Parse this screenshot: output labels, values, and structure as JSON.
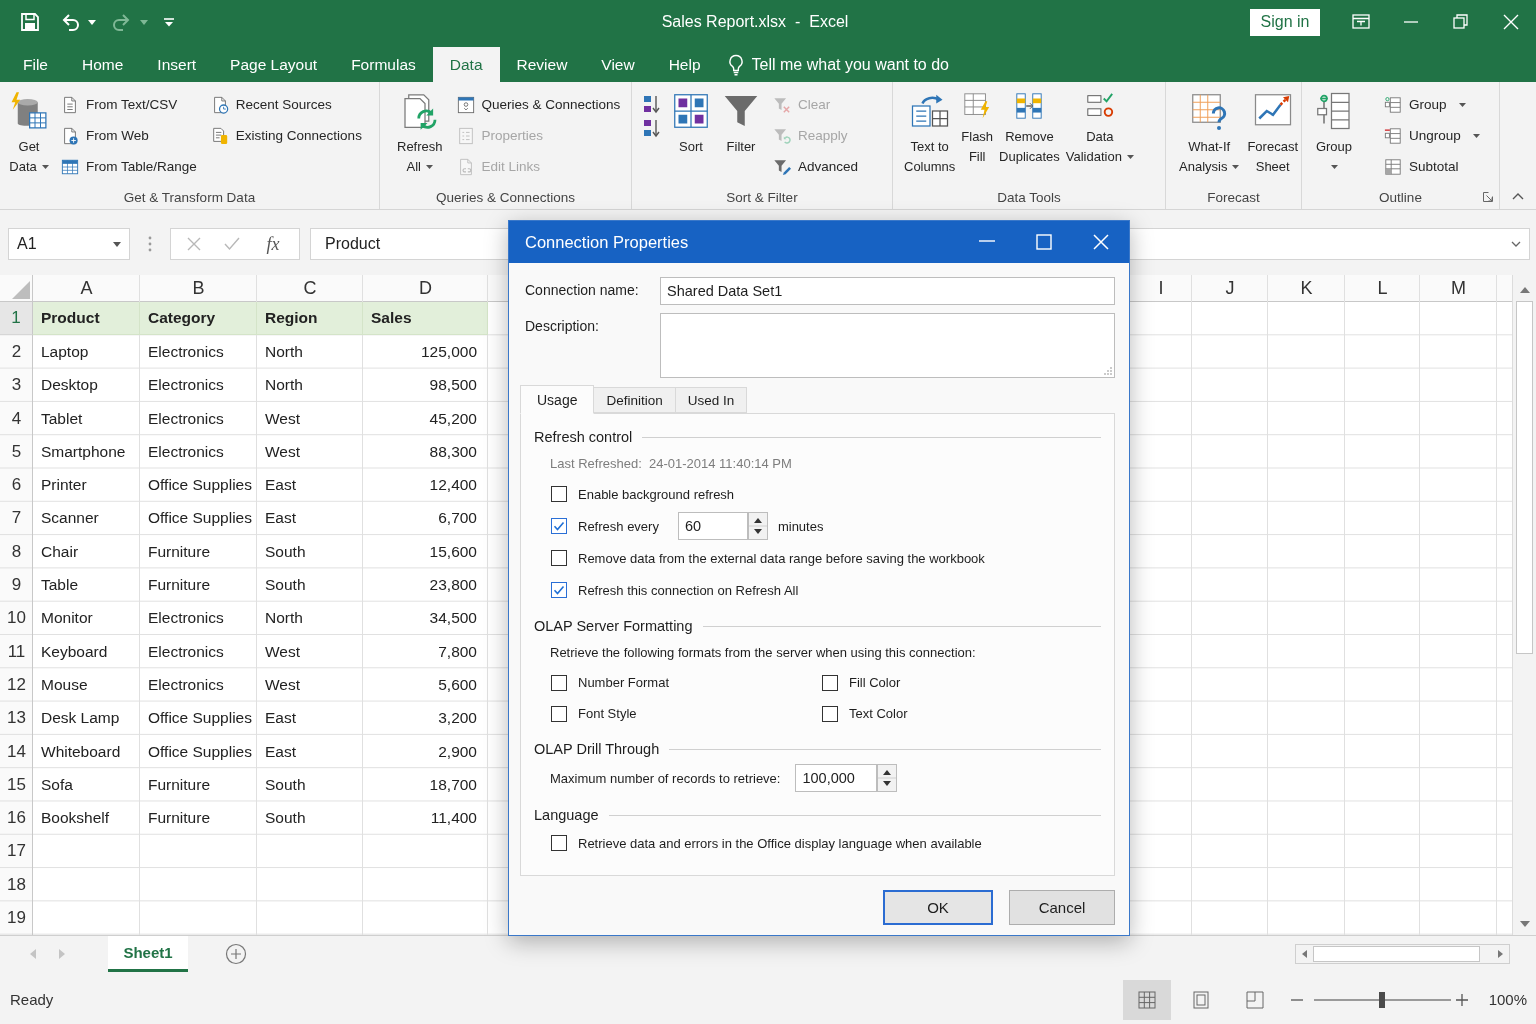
{
  "window": {
    "title": "Sales Report.xlsx  -  Excel",
    "sign_in": "Sign in"
  },
  "quick_access": [
    {
      "kind": "save",
      "disabled": false
    },
    {
      "kind": "undo",
      "disabled": false
    },
    {
      "kind": "redo",
      "disabled": true
    },
    {
      "kind": "customize",
      "disabled": false
    }
  ],
  "menu_tabs": [
    {
      "label": "File",
      "selected": false
    },
    {
      "label": "Home",
      "selected": false
    },
    {
      "label": "Insert",
      "selected": false
    },
    {
      "label": "Page Layout",
      "selected": false
    },
    {
      "label": "Formulas",
      "selected": false
    },
    {
      "label": "Data",
      "selected": true
    },
    {
      "label": "Review",
      "selected": false
    },
    {
      "label": "View",
      "selected": false
    },
    {
      "label": "Help",
      "selected": false
    }
  ],
  "tell_me": {
    "placeholder": "Tell me what you want to do"
  },
  "ribbon": {
    "groups": [
      {
        "label": "Get & Transform Data",
        "columns": [
          [
            {
              "kind": "large",
              "label": "Get\nData",
              "dropdown": true,
              "disabled": false
            }
          ],
          [
            {
              "kind": "small",
              "label": "From Text/CSV",
              "dropdown": false,
              "disabled": false
            },
            {
              "kind": "small",
              "label": "From Web",
              "dropdown": false,
              "disabled": false
            },
            {
              "kind": "small",
              "label": "From Table/Range",
              "dropdown": false,
              "disabled": false
            }
          ],
          [
            {
              "kind": "small",
              "label": "Recent Sources",
              "dropdown": false,
              "disabled": false
            },
            {
              "kind": "small",
              "label": "Existing Connections",
              "dropdown": false,
              "disabled": false
            }
          ]
        ]
      },
      {
        "label": "Queries & Connections",
        "columns": [
          [
            {
              "kind": "large",
              "label": "Refresh\nAll",
              "dropdown": true,
              "disabled": false
            }
          ],
          [
            {
              "kind": "small",
              "label": "Queries & Connections",
              "dropdown": false,
              "disabled": false
            },
            {
              "kind": "small",
              "label": "Properties",
              "dropdown": false,
              "disabled": true
            },
            {
              "kind": "small",
              "label": "Edit Links",
              "dropdown": false,
              "disabled": true
            }
          ]
        ]
      },
      {
        "label": "Sort & Filter",
        "columns": [
          [
            {
              "kind": "icon",
              "dropdown": false,
              "disabled": false
            },
            {
              "kind": "icon",
              "dropdown": false,
              "disabled": false
            }
          ],
          [
            {
              "kind": "large",
              "label": "Sort",
              "dropdown": false,
              "disabled": false
            }
          ],
          [
            {
              "kind": "large",
              "label": "Filter",
              "dropdown": false,
              "disabled": false
            }
          ],
          [
            {
              "kind": "small",
              "label": "Clear",
              "dropdown": false,
              "disabled": true
            },
            {
              "kind": "small",
              "label": "Reapply",
              "dropdown": false,
              "disabled": true
            },
            {
              "kind": "small",
              "label": "Advanced",
              "dropdown": false,
              "disabled": false
            }
          ]
        ]
      },
      {
        "label": "Data Tools",
        "columns": [
          [
            {
              "kind": "large",
              "label": "Text to\nColumns",
              "dropdown": false,
              "disabled": false
            }
          ],
          [
            {
              "kind": "large",
              "label": "Flash\nFill",
              "dropdown": false,
              "disabled": false
            }
          ],
          [
            {
              "kind": "large",
              "label": "Remove\nDuplicates",
              "dropdown": false,
              "disabled": false
            }
          ],
          [
            {
              "kind": "large",
              "label": "Data\nValidation",
              "dropdown": true,
              "disabled": false
            }
          ]
        ]
      },
      {
        "label": "Forecast",
        "columns": [
          [
            {
              "kind": "large",
              "label": "What-If\nAnalysis",
              "dropdown": true,
              "disabled": false
            }
          ],
          [
            {
              "kind": "large",
              "label": "Forecast\nSheet",
              "dropdown": false,
              "disabled": false
            }
          ]
        ]
      },
      {
        "label": "Outline",
        "launcher": true,
        "columns": [
          [
            {
              "kind": "large",
              "label": "Group",
              "dropdown": true,
              "disabled": false
            }
          ],
          [
            {
              "kind": "small",
              "label": "Group",
              "dropdown": true,
              "disabled": false
            },
            {
              "kind": "small",
              "label": "Ungroup",
              "dropdown": true,
              "disabled": false
            },
            {
              "kind": "small",
              "label": "Subtotal",
              "dropdown": false,
              "disabled": false
            }
          ]
        ]
      }
    ]
  },
  "formula_bar": {
    "name_box": "A1",
    "buttons": [
      {
        "kind": "cancel",
        "disabled": true
      },
      {
        "kind": "enter",
        "disabled": true
      },
      {
        "kind": "function",
        "label": "fx",
        "disabled": false
      }
    ],
    "formula": "Product"
  },
  "sheet": {
    "columns": [
      {
        "label": "A",
        "kind": "text"
      },
      {
        "label": "B",
        "kind": "text"
      },
      {
        "label": "C",
        "kind": "text"
      },
      {
        "label": "D",
        "kind": "number"
      },
      {
        "label": "I",
        "kind": "text"
      },
      {
        "label": "J",
        "kind": "text"
      },
      {
        "label": "K",
        "kind": "text"
      },
      {
        "label": "L",
        "kind": "text"
      },
      {
        "label": "M",
        "kind": "text"
      }
    ],
    "header_row": {
      "number": "1",
      "selected": true,
      "cells": [
        "Product",
        "Category",
        "Region",
        "Sales"
      ]
    },
    "rows": [
      {
        "number": "2",
        "selected": false,
        "cells": [
          "Laptop",
          "Electronics",
          "North",
          "125,000"
        ]
      },
      {
        "number": "3",
        "selected": false,
        "cells": [
          "Desktop",
          "Electronics",
          "North",
          "98,500"
        ]
      },
      {
        "number": "4",
        "selected": false,
        "cells": [
          "Tablet",
          "Electronics",
          "West",
          "45,200"
        ]
      },
      {
        "number": "5",
        "selected": false,
        "cells": [
          "Smartphone",
          "Electronics",
          "West",
          "88,300"
        ]
      },
      {
        "number": "6",
        "selected": false,
        "cells": [
          "Printer",
          "Office Supplies",
          "East",
          "12,400"
        ]
      },
      {
        "number": "7",
        "selected": false,
        "cells": [
          "Scanner",
          "Office Supplies",
          "East",
          "6,700"
        ]
      },
      {
        "number": "8",
        "selected": false,
        "cells": [
          "Chair",
          "Furniture",
          "South",
          "15,600"
        ]
      },
      {
        "number": "9",
        "selected": false,
        "cells": [
          "Table",
          "Furniture",
          "South",
          "23,800"
        ]
      },
      {
        "number": "10",
        "selected": false,
        "cells": [
          "Monitor",
          "Electronics",
          "North",
          "34,500"
        ]
      },
      {
        "number": "11",
        "selected": false,
        "cells": [
          "Keyboard",
          "Electronics",
          "West",
          "7,800"
        ]
      },
      {
        "number": "12",
        "selected": false,
        "cells": [
          "Mouse",
          "Electronics",
          "West",
          "5,600"
        ]
      },
      {
        "number": "13",
        "selected": false,
        "cells": [
          "Desk Lamp",
          "Office Supplies",
          "East",
          "3,200"
        ]
      },
      {
        "number": "14",
        "selected": false,
        "cells": [
          "Whiteboard",
          "Office Supplies",
          "East",
          "2,900"
        ]
      },
      {
        "number": "15",
        "selected": false,
        "cells": [
          "Sofa",
          "Furniture",
          "South",
          "18,700"
        ]
      },
      {
        "number": "16",
        "selected": false,
        "cells": [
          "Bookshelf",
          "Furniture",
          "South",
          "11,400"
        ]
      },
      {
        "number": "17",
        "selected": false
      },
      {
        "number": "18",
        "selected": false
      },
      {
        "number": "19",
        "selected": false
      }
    ]
  },
  "sheet_tabs": [
    {
      "label": "Sheet1",
      "selected": true
    }
  ],
  "status_bar": {
    "status": "Ready",
    "views": [
      {
        "kind": "normal",
        "selected": true
      },
      {
        "kind": "page_layout",
        "selected": false
      },
      {
        "kind": "page_break",
        "selected": false
      }
    ],
    "zoom": {
      "level": 0.5,
      "reading": "100%"
    }
  },
  "dialog": {
    "title": "Connection Properties",
    "fields": [
      {
        "kind": "input",
        "label": "Connection name:",
        "value": "Shared Data Set1"
      },
      {
        "kind": "textarea",
        "label": "Description:"
      }
    ],
    "tabs": [
      {
        "label": "Usage",
        "selected": true
      },
      {
        "label": "Definition",
        "selected": false
      },
      {
        "label": "Used In",
        "selected": false
      }
    ],
    "sections": [
      {
        "title": "Refresh control",
        "items": [
          {
            "kind": "note",
            "text": "Last Refreshed:  24-01-2014 11:40:14 PM",
            "disabled": true
          },
          {
            "kind": "checkbox",
            "label": "Enable background refresh",
            "checked": false
          },
          {
            "kind": "checkbox_spinner",
            "label": "Refresh every",
            "checked": true,
            "value": "60",
            "unit": "minutes"
          },
          {
            "kind": "checkbox",
            "label": "Remove data from the external data range before saving the workbook",
            "checked": false
          },
          {
            "kind": "checkbox",
            "label": "Refresh this connection on Refresh All",
            "checked": true
          }
        ]
      },
      {
        "title": "OLAP Server Formatting",
        "items": [
          {
            "kind": "note",
            "text": "Retrieve the following formats from the server when using this connection:",
            "disabled": false
          },
          {
            "kind": "checkbox_grid",
            "options": [
              {
                "label": "Number Format",
                "checked": false
              },
              {
                "label": "Fill Color",
                "checked": false
              },
              {
                "label": "Font Style",
                "checked": false
              },
              {
                "label": "Text Color",
                "checked": false
              }
            ]
          }
        ]
      },
      {
        "title": "OLAP Drill Through",
        "items": [
          {
            "kind": "spinner",
            "label": "Maximum number of records to retrieve:",
            "value": "100,000"
          }
        ]
      },
      {
        "title": "Language",
        "items": [
          {
            "kind": "checkbox",
            "label": "Retrieve data and errors in the Office display language when available",
            "checked": false
          }
        ]
      }
    ],
    "buttons": [
      {
        "label": "OK",
        "default": true
      },
      {
        "label": "Cancel",
        "default": false
      }
    ]
  }
}
